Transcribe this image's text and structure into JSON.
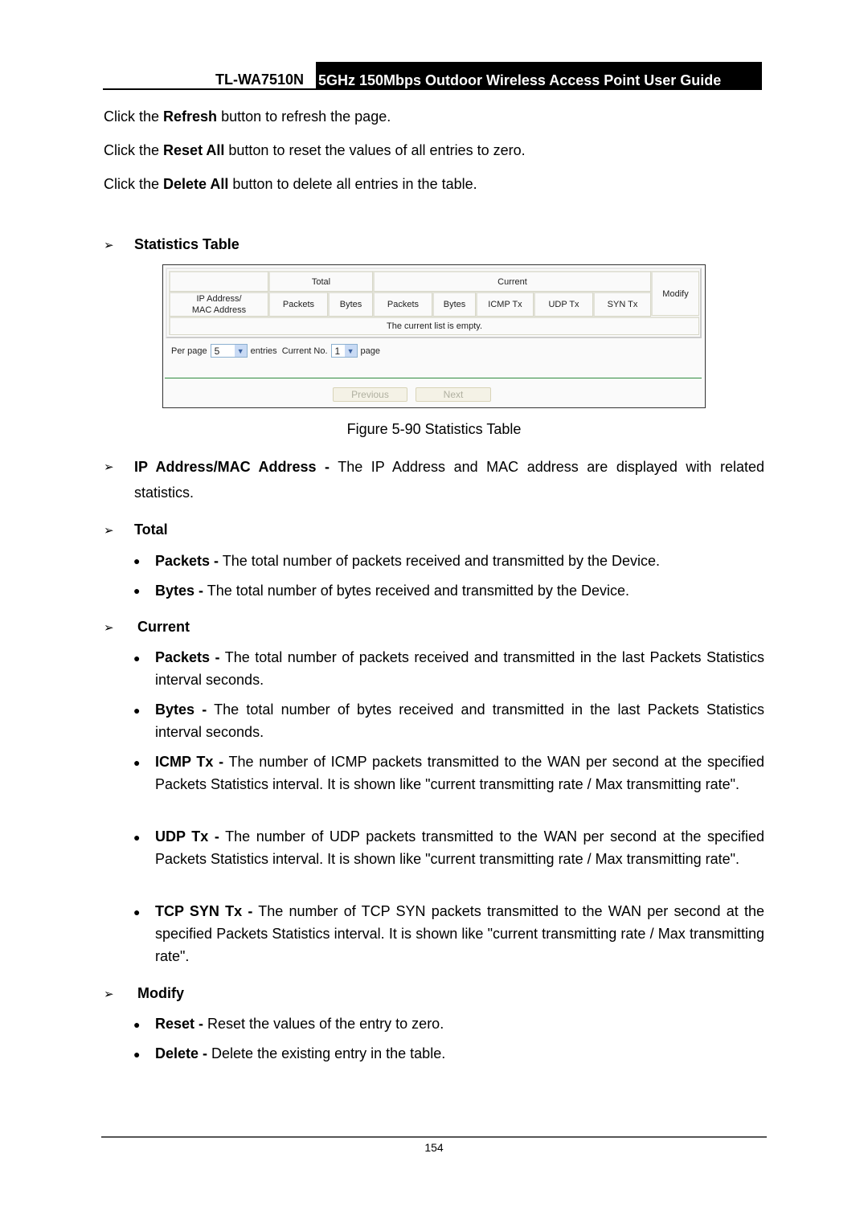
{
  "header": {
    "model": "TL-WA7510N",
    "title": "5GHz 150Mbps Outdoor Wireless Access Point User Guide"
  },
  "intro": [
    {
      "pre": "Click the ",
      "bold": "Refresh",
      "post": " button to refresh the page."
    },
    {
      "pre": "Click the ",
      "bold": "Reset All",
      "post": " button to reset the values of all entries to zero."
    },
    {
      "pre": "Click the ",
      "bold": "Delete All",
      "post": " button to delete all entries in the table."
    }
  ],
  "section_heading": "Statistics Table",
  "figure": {
    "table": {
      "group_total": "Total",
      "group_current": "Current",
      "col_ip_mac": "IP Address/\nMAC Address",
      "col_modify": "Modify",
      "total_cols": [
        "Packets",
        "Bytes"
      ],
      "current_cols": [
        "Packets",
        "Bytes",
        "ICMP Tx",
        "UDP Tx",
        "SYN Tx"
      ],
      "empty_message": "The current list is empty."
    },
    "controls": {
      "per_page_label": "Per page",
      "per_page_value": "5",
      "entries_label": "entries",
      "current_no_label": "Current No.",
      "current_no_value": "1",
      "page_label": "page"
    },
    "buttons": {
      "previous": "Previous",
      "next": "Next"
    },
    "caption": "Figure 5-90 Statistics Table"
  },
  "items": {
    "ip_mac": {
      "bold": "IP Address/MAC Address -",
      "text": " The IP Address and MAC address are displayed with related statistics."
    },
    "total": {
      "heading": "Total",
      "bullets": [
        {
          "bold": "Packets -",
          "text": " The total number of packets received and transmitted by the Device."
        },
        {
          "bold": "Bytes -",
          "text": " The total number of bytes received and transmitted by the Device."
        }
      ]
    },
    "current": {
      "heading": "Current",
      "bullets": [
        {
          "bold": "Packets -",
          "text": " The total number of packets received and transmitted in the last Packets Statistics interval seconds."
        },
        {
          "bold": "Bytes -",
          "text": " The total number of bytes received and transmitted in the last Packets Statistics interval seconds."
        },
        {
          "bold": "ICMP Tx -",
          "text": " The number of ICMP packets transmitted to the WAN per second at the specified Packets Statistics interval. It is shown like \"current transmitting rate / Max transmitting rate\"."
        },
        {
          "bold": "UDP Tx -",
          "text": " The number of UDP packets transmitted to the WAN per second at the specified Packets Statistics interval. It is shown like \"current transmitting rate / Max transmitting rate\"."
        },
        {
          "bold": "TCP SYN Tx -",
          "text": " The number of TCP SYN packets transmitted to the WAN per second at the specified Packets Statistics interval. It is shown like \"current transmitting rate / Max transmitting rate\"."
        }
      ]
    },
    "modify": {
      "heading": "Modify",
      "bullets": [
        {
          "bold": "Reset -",
          "text": " Reset the values of the entry to zero."
        },
        {
          "bold": "Delete -",
          "text": " Delete the existing entry in the table."
        }
      ]
    }
  },
  "glyphs": {
    "arrow": "➢",
    "bullet": "●"
  },
  "footer": {
    "page_number": "154"
  }
}
